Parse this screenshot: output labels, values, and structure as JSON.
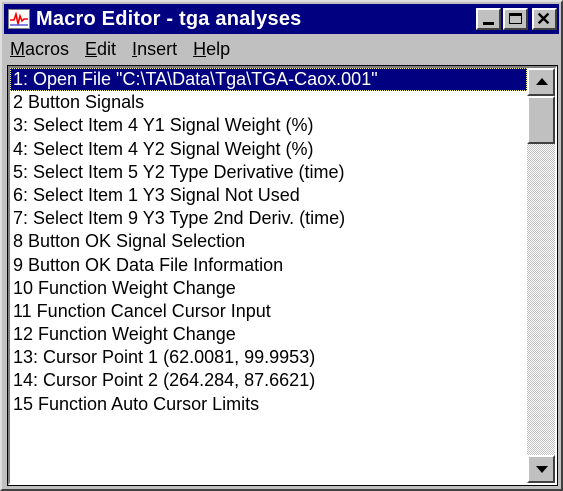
{
  "window": {
    "title": "Macro Editor - tga analyses",
    "icon": "waveform-icon"
  },
  "menu": [
    {
      "mnemonic": "M",
      "rest": "acros"
    },
    {
      "mnemonic": "E",
      "rest": "dit"
    },
    {
      "mnemonic": "I",
      "rest": "nsert"
    },
    {
      "mnemonic": "H",
      "rest": "elp"
    }
  ],
  "macro_list": {
    "selected_index": 0,
    "items": [
      "1: Open File \"C:\\TA\\Data\\Tga\\TGA-Caox.001\"",
      "2 Button Signals",
      "3: Select Item 4 Y1 Signal Weight (%)",
      "4: Select Item 4 Y2 Signal Weight (%)",
      "5: Select Item 5 Y2 Type Derivative (time)",
      "6: Select Item 1 Y3 Signal Not Used",
      "7: Select Item 9 Y3 Type 2nd Deriv. (time)",
      "8 Button OK Signal Selection",
      "9 Button OK Data File Information",
      "10 Function Weight Change",
      "11 Function Cancel Cursor Input",
      "12 Function Weight Change",
      "13: Cursor Point 1 (62.0081, 99.9953)",
      "14: Cursor Point 2 (264.284, 87.6621)",
      "15 Function Auto Cursor Limits"
    ]
  }
}
